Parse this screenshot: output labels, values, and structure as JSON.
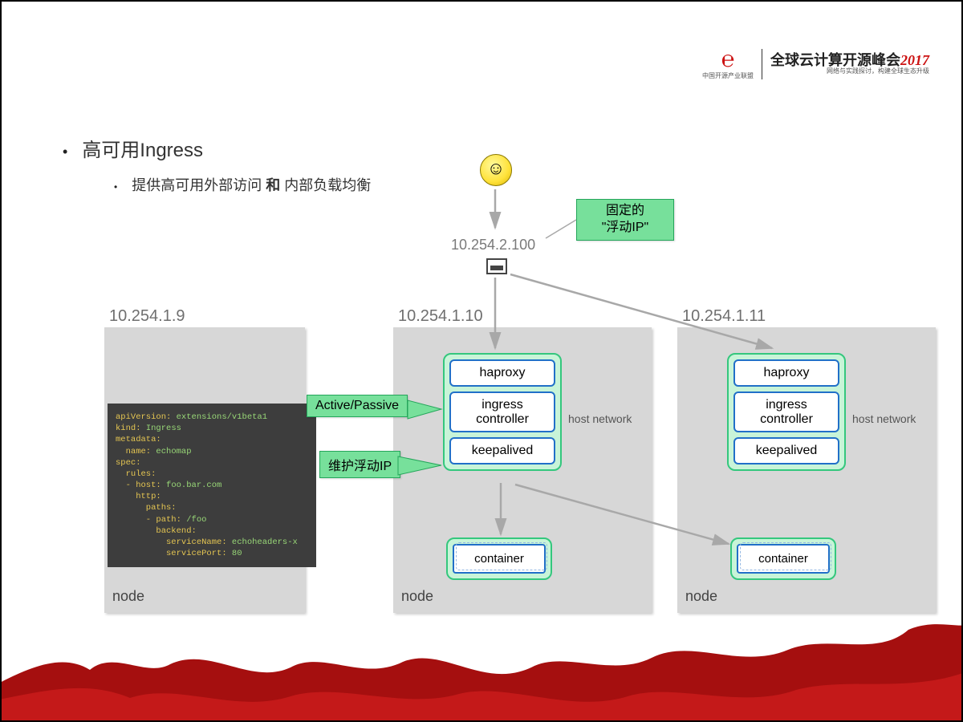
{
  "header": {
    "logo_mark": "℮",
    "logo_title_main": "全球云计算开源峰会",
    "logo_year": "2017",
    "logo_sub1": "网络与实践探讨，构建全球生态升级",
    "logo_sub2": "中国开源产业联盟"
  },
  "bullets": {
    "main": "高可用Ingress",
    "sub_pre": "提供高可用外部访问 ",
    "sub_bold": "和",
    "sub_post": " 内部负载均衡"
  },
  "vip": {
    "ip": "10.254.2.100",
    "float_label_line1": "固定的",
    "float_label_line2": "\"浮动IP\""
  },
  "labels": {
    "active_passive": "Active/Passive",
    "keepalived_note": "维护浮动IP",
    "host_network": "host network"
  },
  "nodes": {
    "n1": {
      "ip": "10.254.1.9",
      "name": "node"
    },
    "n2": {
      "ip": "10.254.1.10",
      "name": "node"
    },
    "n3": {
      "ip": "10.254.1.11",
      "name": "node"
    }
  },
  "pod": {
    "p1": "haproxy",
    "p2": "ingress controller",
    "p3": "keepalived",
    "container": "container"
  },
  "yaml": {
    "l1a": "apiVersion:",
    "l1b": " extensions/v1beta1",
    "l2a": "kind:",
    "l2b": " Ingress",
    "l3a": "metadata:",
    "l4a": "  name:",
    "l4b": " echomap",
    "l5a": "spec:",
    "l6a": "  rules:",
    "l7a": "  - host:",
    "l7b": " foo.bar.com",
    "l8a": "    http:",
    "l9a": "      paths:",
    "l10a": "      - path:",
    "l10b": " /foo",
    "l11a": "        backend:",
    "l12a": "          serviceName:",
    "l12b": " echoheaders-x",
    "l13a": "          servicePort:",
    "l13b": " 80"
  }
}
